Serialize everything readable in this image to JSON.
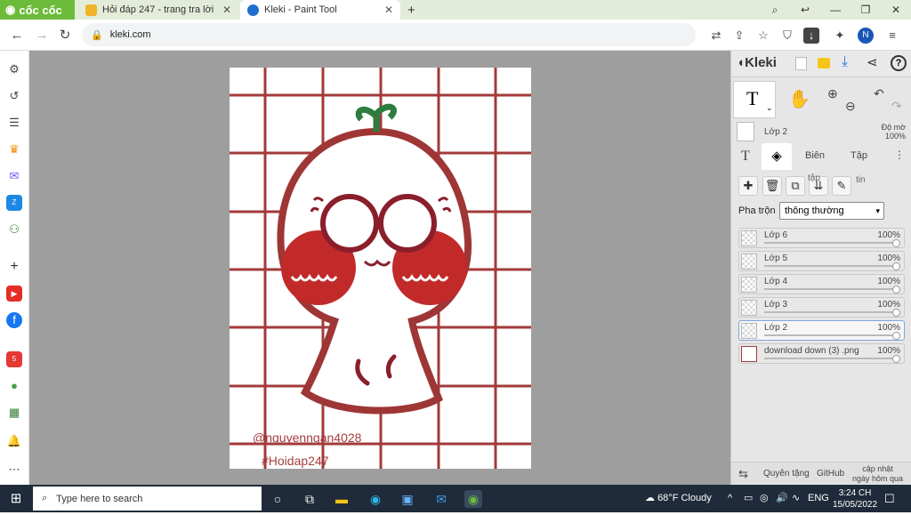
{
  "browser": {
    "brand": "cốc cốc",
    "tabs": [
      {
        "title": "Hỏi đáp 247 - trang tra lời",
        "active": false
      },
      {
        "title": "Kleki - Paint Tool",
        "active": true
      }
    ],
    "url": "kleki.com",
    "profile_initial": "N"
  },
  "app": {
    "logo": "Kleki",
    "current_layer": "Lớp 2",
    "opacity_label": "Độ mờ",
    "opacity_value": "100%",
    "tabs": [
      "Biên",
      "Tập"
    ],
    "tap_tin_label_1": "tập",
    "tap_tin_label_2": "tin",
    "blend_label": "Pha trộn",
    "blend_value": "thông thường",
    "layers": [
      {
        "name": "Lớp 6",
        "opacity": "100%"
      },
      {
        "name": "Lớp 5",
        "opacity": "100%"
      },
      {
        "name": "Lớp 4",
        "opacity": "100%"
      },
      {
        "name": "Lớp 3",
        "opacity": "100%"
      },
      {
        "name": "Lớp 2",
        "opacity": "100%"
      },
      {
        "name": "download down (3) .png",
        "opacity": "100%"
      }
    ],
    "footer": {
      "donate": "Quyên tặng",
      "github": "GitHub",
      "update_line1": "cập nhật",
      "update_line2": "ngày hôm qua"
    }
  },
  "canvas": {
    "watermark_1": "@nguyenngan4028",
    "watermark_2": "#Hoidap247"
  },
  "taskbar": {
    "search_placeholder": "Type here to search",
    "weather": "68°F  Cloudy",
    "lang": "ENG",
    "time": "3:24 CH",
    "date": "15/05/2022"
  },
  "colors": {
    "grid": "#a33a3a",
    "outline": "#9e3636",
    "cheek": "#c22a2a",
    "sprout": "#2e7d3e",
    "accent": "#6dbb3a"
  }
}
